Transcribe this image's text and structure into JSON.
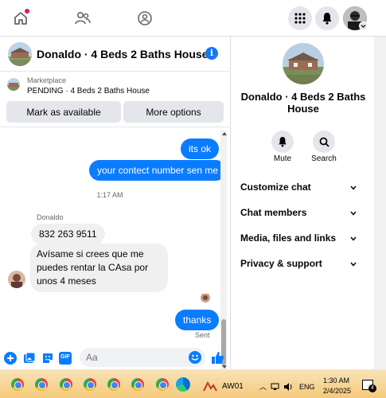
{
  "listing_title": "Donaldo · 4 Beds 2 Baths House",
  "marketplace": {
    "label": "Marketplace",
    "status_line": "PENDING · 4 Beds 2 Baths House",
    "mark_available": "Mark as available",
    "more_options": "More options"
  },
  "messages": {
    "me_1": "its ok",
    "me_2": "your contect number sen me",
    "time_sep": "1:17 AM",
    "sender": "Donaldo",
    "them_1": "832 263 9511",
    "them_2": "Avísame si crees que me puedes rentar la CAsa por unos 4 meses",
    "me_3": "thanks",
    "sent_status": "Sent"
  },
  "composer": {
    "placeholder": "Aa",
    "gif_label": "GIF"
  },
  "right_panel": {
    "title": "Donaldo · 4 Beds 2 Baths House",
    "mute_label": "Mute",
    "search_label": "Search",
    "sections": [
      "Customize chat",
      "Chat members",
      "Media, files and links",
      "Privacy & support"
    ]
  },
  "taskbar": {
    "app_label": "AW01",
    "lang": "ENG",
    "time": "1:30 AM",
    "date": "2/4/2025",
    "notif_count": "4"
  },
  "colors": {
    "accent": "#0a7cff",
    "brand": "#1877f2",
    "notification_red": "#e41e3f"
  }
}
